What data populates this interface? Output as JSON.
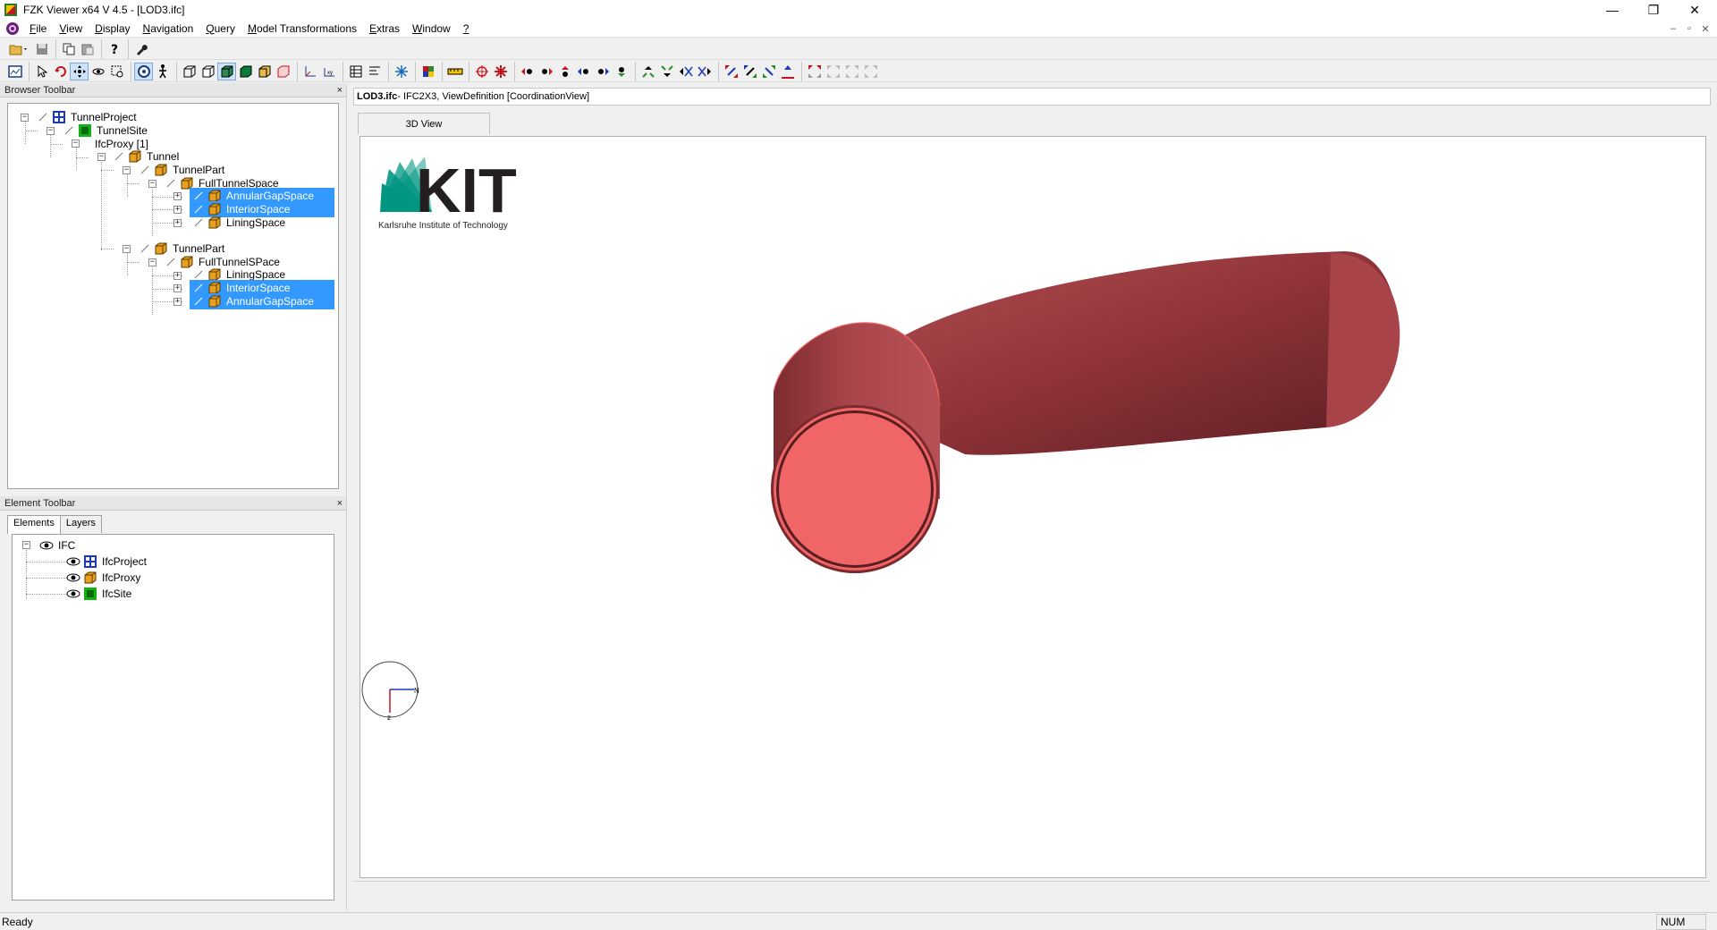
{
  "window": {
    "title": "FZK Viewer x64 V 4.5 - [LOD3.ifc]",
    "controls": {
      "minimize": "—",
      "restore": "❐",
      "close": "✕"
    }
  },
  "menu": {
    "items": [
      {
        "label": "File",
        "accel": "F"
      },
      {
        "label": "View",
        "accel": "V"
      },
      {
        "label": "Display",
        "accel": "D"
      },
      {
        "label": "Navigation",
        "accel": "N"
      },
      {
        "label": "Query",
        "accel": "Q"
      },
      {
        "label": "Model Transformations",
        "accel": "M"
      },
      {
        "label": "Extras",
        "accel": "E"
      },
      {
        "label": "Window",
        "accel": "W"
      },
      {
        "label": "?",
        "accel": "?"
      }
    ],
    "mdi_controls": {
      "minimize": "–",
      "restore": "▫",
      "close": "✕"
    }
  },
  "browser_toolbar": {
    "title": "Browser Toolbar",
    "close": "×",
    "tree": [
      {
        "label": "TunnelProject",
        "icon": "project-icon",
        "selected": false
      },
      {
        "label": "TunnelSite",
        "icon": "site-icon",
        "selected": false
      },
      {
        "label": "IfcProxy [1]",
        "icon": "none",
        "selected": false
      },
      {
        "label": "Tunnel",
        "icon": "proxy-icon",
        "selected": false
      },
      {
        "label": "TunnelPart",
        "icon": "proxy-icon",
        "selected": false
      },
      {
        "label": "FullTunnelSpace",
        "icon": "proxy-icon",
        "selected": false
      },
      {
        "label": "AnnularGapSpace",
        "icon": "proxy-icon",
        "selected": true
      },
      {
        "label": "InteriorSpace",
        "icon": "proxy-icon",
        "selected": true
      },
      {
        "label": "LiningSpace",
        "icon": "proxy-icon",
        "selected": false
      },
      {
        "label": "TunnelPart",
        "icon": "proxy-icon",
        "selected": false
      },
      {
        "label": "FullTunnelSPace",
        "icon": "proxy-icon",
        "selected": false
      },
      {
        "label": "LiningSpace",
        "icon": "proxy-icon",
        "selected": false
      },
      {
        "label": "InteriorSpace",
        "icon": "proxy-icon",
        "selected": true
      },
      {
        "label": "AnnularGapSpace",
        "icon": "proxy-icon",
        "selected": true
      }
    ]
  },
  "element_toolbar": {
    "title": "Element Toolbar",
    "close": "×",
    "tabs": [
      {
        "label": "Elements",
        "active": true
      },
      {
        "label": "Layers",
        "active": false
      }
    ],
    "tree": [
      {
        "label": "IFC",
        "icon": "eye-icon"
      },
      {
        "label": "IfcProject",
        "icon": "project-icon"
      },
      {
        "label": "IfcProxy",
        "icon": "proxy-icon"
      },
      {
        "label": "IfcSite",
        "icon": "site-icon"
      }
    ]
  },
  "document": {
    "filename": "LOD3.ifc",
    "info": " - IFC2X3, ViewDefinition [CoordinationView]",
    "view_tab": "3D View",
    "logo": {
      "text": "KIT",
      "subtitle": "Karlsruhe Institute of Technology"
    },
    "model_color": "#a8454a",
    "face_color": "#f06666",
    "compass": {
      "n": "N",
      "z": "z"
    }
  },
  "status": {
    "text": "Ready",
    "num": "NUM"
  },
  "colors": {
    "selection": "#3399ff",
    "logo_green": "#009682",
    "logo_dark": "#231f20"
  }
}
